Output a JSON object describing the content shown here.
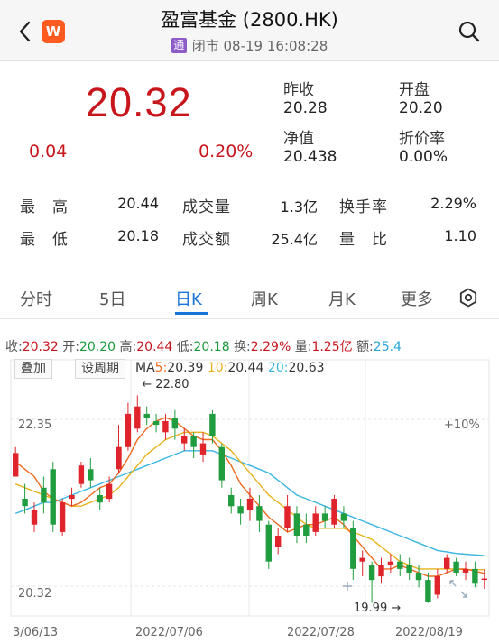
{
  "header": {
    "title": "盈富基金 (2800.HK)",
    "badge": "通",
    "status": "闭市 08-19 16:08:28",
    "logo_letter": "W",
    "icons": {
      "back": "chevron-left-icon",
      "search": "search-icon"
    }
  },
  "quote": {
    "price": "20.32",
    "change": "0.04",
    "change_pct": "0.20%",
    "prev_close_label": "昨收",
    "prev_close": "20.28",
    "open_label": "开盘",
    "open": "20.20",
    "nav_label": "净值",
    "nav": "20.438",
    "discount_label": "折价率",
    "discount": "0.00%"
  },
  "stats": {
    "high_label": "最　高",
    "high": "20.44",
    "low_label": "最　低",
    "low": "20.18",
    "volume_label": "成交量",
    "volume": "1.3亿",
    "turnover_label": "成交额",
    "turnover": "25.4亿",
    "turnover_rate_label": "换手率",
    "turnover_rate": "2.29%",
    "vol_ratio_label": "量　比",
    "vol_ratio": "1.10"
  },
  "tabs": [
    {
      "label": "分时"
    },
    {
      "label": "5日"
    },
    {
      "label": "日K"
    },
    {
      "label": "周K"
    },
    {
      "label": "月K"
    },
    {
      "label": "更多"
    }
  ],
  "active_tab": "日K",
  "indicators": {
    "close_label": "收:",
    "close": "20.32",
    "open_label": "开:",
    "open": "20.20",
    "high_label": "高:",
    "high": "20.44",
    "low_label": "低:",
    "low": "20.18",
    "turn_label": "换:",
    "turn": "2.29%",
    "vol_label": "量:",
    "vol": "1.25亿",
    "amt_label": "额:",
    "amt": "25.4"
  },
  "chart_controls": {
    "overlay": "叠加",
    "set_period": "设周期"
  },
  "ma": {
    "label": "MA",
    "ma5_label": "5:",
    "ma5": "20.39",
    "ma10_label": "10:",
    "ma10": "20.44",
    "ma20_label": "20:",
    "ma20": "20.63"
  },
  "colors": {
    "up": "#e0242b",
    "down": "#1f9d3f",
    "ma5": "#ee6a1e",
    "ma10": "#e8b21c",
    "ma20": "#3bb6e0",
    "accent": "#1a73d9"
  },
  "chart_data": {
    "type": "candlestick",
    "y_labels": {
      "top": "22.35",
      "bottom": "20.32",
      "right_top": "+10%"
    },
    "annotations": {
      "max": "22.80",
      "min": "19.99"
    },
    "x_labels": [
      "3/06/13",
      "2022/07/06",
      "2022/07/28",
      "2022/08/19"
    ],
    "ylim": [
      19.85,
      23.0
    ],
    "candles": [
      {
        "o": 21.7,
        "c": 22.02,
        "h": 22.1,
        "l": 21.7
      },
      {
        "o": 21.4,
        "c": 21.3,
        "h": 21.6,
        "l": 21.2
      },
      {
        "o": 21.05,
        "c": 21.25,
        "h": 21.35,
        "l": 20.95
      },
      {
        "o": 21.55,
        "c": 21.35,
        "h": 21.7,
        "l": 21.2
      },
      {
        "o": 21.8,
        "c": 21.05,
        "h": 21.9,
        "l": 20.95
      },
      {
        "o": 20.95,
        "c": 21.35,
        "h": 21.4,
        "l": 20.9
      },
      {
        "o": 21.4,
        "c": 21.45,
        "h": 21.55,
        "l": 21.3
      },
      {
        "o": 21.6,
        "c": 21.85,
        "h": 21.9,
        "l": 21.55
      },
      {
        "o": 21.8,
        "c": 21.65,
        "h": 21.95,
        "l": 21.55
      },
      {
        "o": 21.45,
        "c": 21.35,
        "h": 21.55,
        "l": 21.25
      },
      {
        "o": 21.4,
        "c": 21.6,
        "h": 21.7,
        "l": 21.35
      },
      {
        "o": 21.8,
        "c": 22.1,
        "h": 22.4,
        "l": 21.75
      },
      {
        "o": 22.1,
        "c": 22.55,
        "h": 22.7,
        "l": 22.05
      },
      {
        "o": 22.35,
        "c": 22.65,
        "h": 22.8,
        "l": 22.3
      },
      {
        "o": 22.55,
        "c": 22.5,
        "h": 22.65,
        "l": 22.4
      },
      {
        "o": 22.45,
        "c": 22.4,
        "h": 22.55,
        "l": 22.3
      },
      {
        "o": 22.3,
        "c": 22.45,
        "h": 22.55,
        "l": 22.2
      },
      {
        "o": 22.5,
        "c": 22.35,
        "h": 22.6,
        "l": 22.2
      },
      {
        "o": 22.15,
        "c": 22.25,
        "h": 22.35,
        "l": 22.05
      },
      {
        "o": 22.25,
        "c": 22.1,
        "h": 22.3,
        "l": 21.95
      },
      {
        "o": 22.0,
        "c": 22.15,
        "h": 22.3,
        "l": 21.9
      },
      {
        "o": 22.55,
        "c": 22.25,
        "h": 22.6,
        "l": 22.15
      },
      {
        "o": 22.1,
        "c": 21.65,
        "h": 22.15,
        "l": 21.55
      },
      {
        "o": 21.45,
        "c": 21.3,
        "h": 21.55,
        "l": 21.2
      },
      {
        "o": 21.3,
        "c": 21.2,
        "h": 21.4,
        "l": 21.05
      },
      {
        "o": 21.25,
        "c": 21.4,
        "h": 21.55,
        "l": 21.1
      },
      {
        "o": 21.3,
        "c": 21.1,
        "h": 21.45,
        "l": 20.95
      },
      {
        "o": 21.05,
        "c": 20.55,
        "h": 21.1,
        "l": 20.45
      },
      {
        "o": 20.75,
        "c": 20.9,
        "h": 21.0,
        "l": 20.65
      },
      {
        "o": 21.0,
        "c": 21.3,
        "h": 21.45,
        "l": 20.95
      },
      {
        "o": 21.2,
        "c": 20.9,
        "h": 21.3,
        "l": 20.8
      },
      {
        "o": 21.05,
        "c": 20.9,
        "h": 21.2,
        "l": 20.8
      },
      {
        "o": 20.95,
        "c": 21.2,
        "h": 21.3,
        "l": 20.9
      },
      {
        "o": 21.2,
        "c": 21.1,
        "h": 21.3,
        "l": 21.0
      },
      {
        "o": 21.05,
        "c": 21.4,
        "h": 21.45,
        "l": 21.0
      },
      {
        "o": 21.2,
        "c": 21.1,
        "h": 21.3,
        "l": 21.0
      },
      {
        "o": 21.0,
        "c": 20.45,
        "h": 21.1,
        "l": 20.3
      },
      {
        "o": 20.55,
        "c": 20.6,
        "h": 20.7,
        "l": 20.35
      },
      {
        "o": 20.5,
        "c": 20.3,
        "h": 20.55,
        "l": 19.99
      },
      {
        "o": 20.35,
        "c": 20.5,
        "h": 20.6,
        "l": 20.25
      },
      {
        "o": 20.5,
        "c": 20.55,
        "h": 20.65,
        "l": 20.4
      },
      {
        "o": 20.55,
        "c": 20.45,
        "h": 20.65,
        "l": 20.35
      },
      {
        "o": 20.5,
        "c": 20.4,
        "h": 20.6,
        "l": 20.3
      },
      {
        "o": 20.4,
        "c": 20.3,
        "h": 20.5,
        "l": 20.2
      },
      {
        "o": 20.3,
        "c": 20.0,
        "h": 20.4,
        "l": 19.99
      },
      {
        "o": 20.1,
        "c": 20.35,
        "h": 20.45,
        "l": 20.05
      },
      {
        "o": 20.45,
        "c": 20.6,
        "h": 20.65,
        "l": 20.4
      },
      {
        "o": 20.55,
        "c": 20.4,
        "h": 20.6,
        "l": 20.35
      },
      {
        "o": 20.4,
        "c": 20.45,
        "h": 20.55,
        "l": 20.3
      },
      {
        "o": 20.45,
        "c": 20.25,
        "h": 20.55,
        "l": 20.2
      },
      {
        "o": 20.3,
        "c": 20.32,
        "h": 20.44,
        "l": 20.18
      }
    ],
    "ma5": [
      21.9,
      21.8,
      21.7,
      21.5,
      21.4,
      21.35,
      21.3,
      21.35,
      21.45,
      21.55,
      21.6,
      21.75,
      21.95,
      22.2,
      22.35,
      22.45,
      22.5,
      22.45,
      22.35,
      22.25,
      22.2,
      22.2,
      22.05,
      21.85,
      21.6,
      21.45,
      21.3,
      21.15,
      21.05,
      20.95,
      21.0,
      21.05,
      21.05,
      21.1,
      21.15,
      21.05,
      20.9,
      20.75,
      20.6,
      20.45,
      20.45,
      20.5,
      20.45,
      20.4,
      20.35,
      20.35,
      20.4,
      20.45,
      20.45,
      20.42,
      20.39
    ],
    "ma10": [
      21.6,
      21.55,
      21.5,
      21.45,
      21.4,
      21.35,
      21.3,
      21.3,
      21.35,
      21.4,
      21.45,
      21.55,
      21.7,
      21.85,
      22.0,
      22.1,
      22.2,
      22.25,
      22.3,
      22.3,
      22.3,
      22.25,
      22.15,
      22.05,
      21.9,
      21.75,
      21.6,
      21.45,
      21.35,
      21.25,
      21.15,
      21.05,
      21.0,
      21.0,
      21.0,
      21.0,
      20.95,
      20.9,
      20.85,
      20.75,
      20.65,
      20.55,
      20.5,
      20.45,
      20.45,
      20.45,
      20.45,
      20.45,
      20.44,
      20.44,
      20.44
    ],
    "ma20": [
      21.2,
      21.25,
      21.3,
      21.35,
      21.35,
      21.4,
      21.45,
      21.5,
      21.55,
      21.6,
      21.65,
      21.7,
      21.75,
      21.8,
      21.85,
      21.9,
      21.95,
      22.0,
      22.05,
      22.05,
      22.05,
      22.05,
      22.0,
      21.95,
      21.9,
      21.85,
      21.8,
      21.75,
      21.65,
      21.55,
      21.45,
      21.4,
      21.35,
      21.3,
      21.25,
      21.2,
      21.15,
      21.1,
      21.05,
      21.0,
      20.95,
      20.9,
      20.85,
      20.8,
      20.75,
      20.7,
      20.68,
      20.66,
      20.65,
      20.64,
      20.63
    ]
  }
}
